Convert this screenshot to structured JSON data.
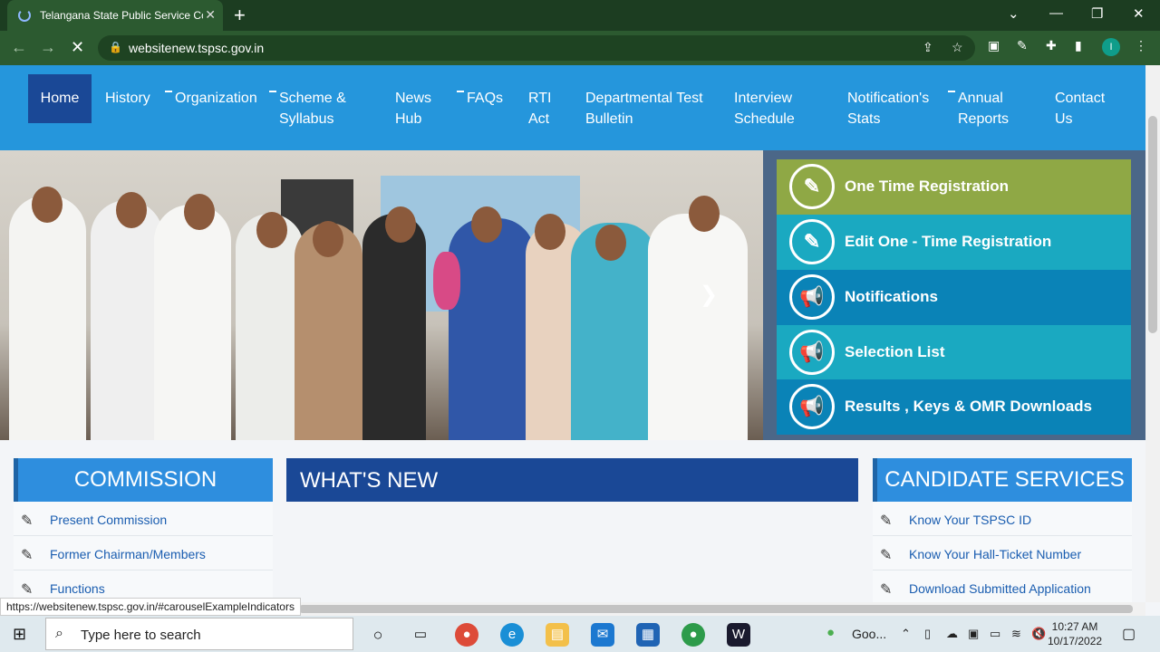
{
  "browser": {
    "tab_title": "Telangana State Public Service Co",
    "url": "websitenew.tspsc.gov.in",
    "status_url": "https://websitenew.tspsc.gov.in/#carouselExampleIndicators",
    "profile_initial": "I"
  },
  "nav": {
    "home": "Home",
    "history": "History",
    "organization": "Organization",
    "scheme_1": "Scheme &",
    "scheme_2": "Syllabus",
    "news_1": "News",
    "news_2": "Hub",
    "faqs": "FAQs",
    "rti_1": "RTI",
    "rti_2": "Act",
    "dept_1": "Departmental Test",
    "dept_2": "Bulletin",
    "interview_1": "Interview",
    "interview_2": "Schedule",
    "notif_1": "Notification's",
    "notif_2": "Stats",
    "annual_1": "Annual",
    "annual_2": "Reports",
    "contact_1": "Contact",
    "contact_2": "Us"
  },
  "side_buttons": [
    {
      "label": "One Time Registration",
      "color": "#8fa845",
      "icon": "edit-icon"
    },
    {
      "label": "Edit One - Time Registration",
      "color": "#1aa9c1",
      "icon": "edit-icon"
    },
    {
      "label": "Notifications",
      "color": "#0a83b7",
      "icon": "megaphone-icon"
    },
    {
      "label": "Selection List",
      "color": "#1aa9c1",
      "icon": "megaphone-icon"
    },
    {
      "label": "Results , Keys & OMR Downloads",
      "color": "#0a83b7",
      "icon": "megaphone-icon"
    }
  ],
  "commission": {
    "title": "COMMISSION",
    "links": [
      "Present Commission",
      "Former Chairman/Members",
      "Functions"
    ]
  },
  "whats_new": {
    "title": "WHAT'S NEW"
  },
  "candidate": {
    "title": "CANDIDATE SERVICES",
    "links": [
      "Know Your TSPSC ID",
      "Know Your Hall-Ticket Number",
      "Download Submitted Application"
    ]
  },
  "taskbar": {
    "search_placeholder": "Type here to search",
    "tray_app": "Goo...",
    "time": "10:27 AM",
    "date": "10/17/2022"
  }
}
